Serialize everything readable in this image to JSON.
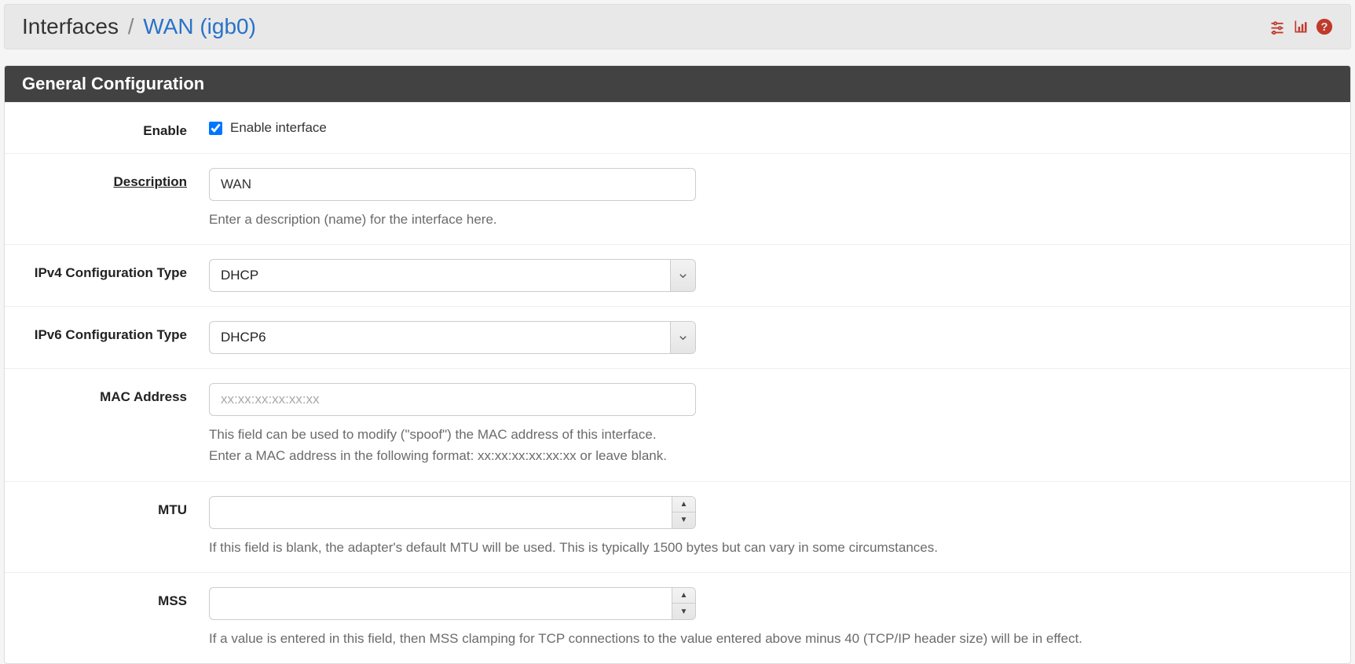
{
  "breadcrumb": {
    "root": "Interfaces",
    "current": "WAN (igb0)"
  },
  "panel": {
    "title": "General Configuration"
  },
  "fields": {
    "enable": {
      "label": "Enable",
      "checkbox_label": "Enable interface",
      "checked": true
    },
    "description": {
      "label": "Description",
      "value": "WAN",
      "help": "Enter a description (name) for the interface here."
    },
    "ipv4": {
      "label": "IPv4 Configuration Type",
      "value": "DHCP"
    },
    "ipv6": {
      "label": "IPv6 Configuration Type",
      "value": "DHCP6"
    },
    "mac": {
      "label": "MAC Address",
      "placeholder": "xx:xx:xx:xx:xx:xx",
      "value": "",
      "help": "This field can be used to modify (\"spoof\") the MAC address of this interface.\nEnter a MAC address in the following format: xx:xx:xx:xx:xx:xx or leave blank."
    },
    "mtu": {
      "label": "MTU",
      "value": "",
      "help": "If this field is blank, the adapter's default MTU will be used. This is typically 1500 bytes but can vary in some circumstances."
    },
    "mss": {
      "label": "MSS",
      "value": "",
      "help": "If a value is entered in this field, then MSS clamping for TCP connections to the value entered above minus 40 (TCP/IP header size) will be in effect."
    }
  }
}
